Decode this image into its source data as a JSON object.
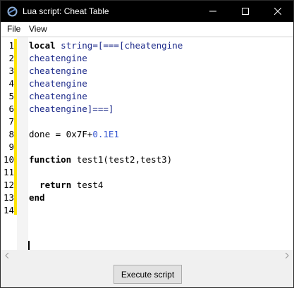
{
  "window": {
    "title": "Lua script: Cheat Table",
    "icon": "cheat-engine-icon",
    "controls": [
      "minimize-icon",
      "maximize-icon",
      "close-icon"
    ]
  },
  "menu": {
    "file": "File",
    "view": "View"
  },
  "editor": {
    "line_numbers": [
      "1",
      "2",
      "3",
      "4",
      "5",
      "6",
      "7",
      "8",
      "9",
      "10",
      "11",
      "12",
      "13",
      "14"
    ],
    "lines": [
      [
        {
          "t": "local",
          "c": "kw"
        },
        {
          "t": " string=[===[cheatengine",
          "c": "str"
        }
      ],
      [
        {
          "t": "cheatengine",
          "c": "str"
        }
      ],
      [
        {
          "t": "cheatengine",
          "c": "str"
        }
      ],
      [
        {
          "t": "cheatengine",
          "c": "str"
        }
      ],
      [
        {
          "t": "cheatengine",
          "c": "str"
        }
      ],
      [
        {
          "t": "cheatengine]===]",
          "c": "str"
        }
      ],
      [],
      [
        {
          "t": "done = 0x7F+",
          "c": ""
        },
        {
          "t": "0.1E1",
          "c": "num"
        }
      ],
      [],
      [
        {
          "t": "function",
          "c": "kw"
        },
        {
          "t": " test1(test2,test3)",
          "c": ""
        }
      ],
      [],
      [
        {
          "t": "  ",
          "c": ""
        },
        {
          "t": "return",
          "c": "kw"
        },
        {
          "t": " test4",
          "c": ""
        }
      ],
      [
        {
          "t": "end",
          "c": "kw"
        }
      ],
      []
    ],
    "colors": {
      "changed_line_marker": "#ffe500",
      "string": "#1c2a8a",
      "number": "#3656d1"
    }
  },
  "footer": {
    "execute_label": "Execute script"
  }
}
